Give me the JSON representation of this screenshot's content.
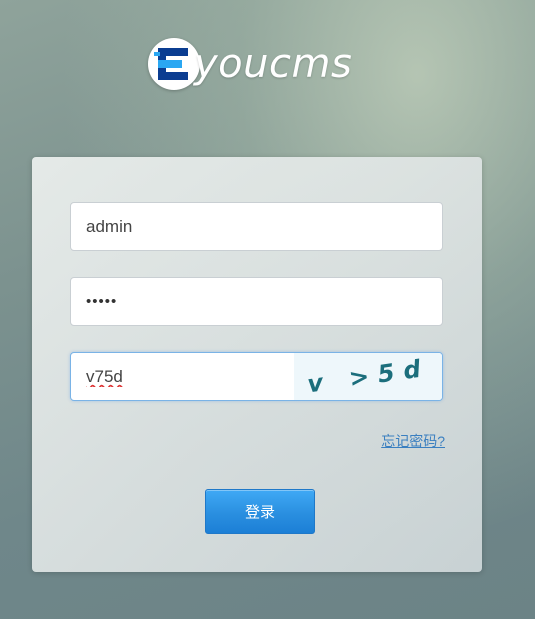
{
  "brand": {
    "logo_letter": "E",
    "logo_text": "youcms",
    "logo_colors": {
      "dark": "#0b3d91",
      "accent": "#2aa7f2"
    }
  },
  "login_form": {
    "username_value": "admin",
    "password_value": "•••••",
    "captcha_value": "v75d",
    "captcha_image_text": "v >5d",
    "captcha_color": "#1b6e7c",
    "forgot_label": "忘记密码?",
    "submit_label": "登录",
    "accent_color": "#2a8fe0"
  }
}
